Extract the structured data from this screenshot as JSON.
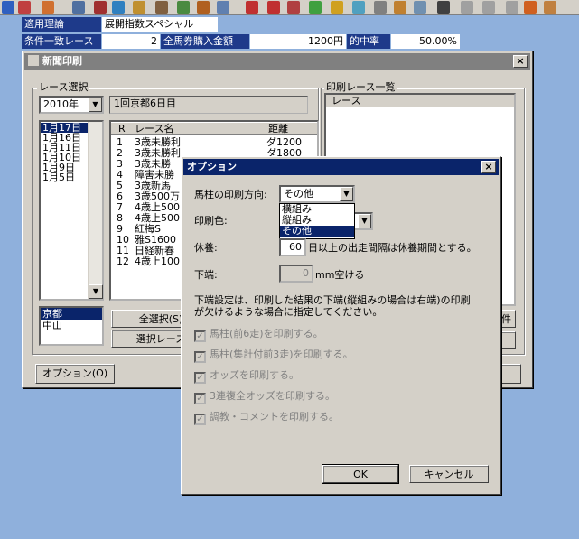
{
  "info": {
    "theory_label": "適用理論",
    "theory_value": "展開指数スペシャル",
    "match_label": "条件一致レース",
    "match_count": "2",
    "total_label": "全馬券購入金額",
    "total_value": "1200円",
    "hit_label": "的中率",
    "hit_value": "50.00%"
  },
  "print_window": {
    "title": "新聞印刷",
    "race_select_group": "レース選択",
    "year": "2010年",
    "meeting": "1回京都6日目",
    "dates": [
      "1月17日",
      "1月16日",
      "1月11日",
      "1月10日",
      "1月9日",
      "1月5日"
    ],
    "venues": [
      "京都",
      "中山"
    ],
    "race_header": {
      "r": "R",
      "name": "レース名",
      "dist": "距離"
    },
    "races": [
      {
        "r": "1",
        "name": "3歳未勝利",
        "dist": "ダ1200"
      },
      {
        "r": "2",
        "name": "3歳未勝利",
        "dist": "ダ1800"
      },
      {
        "r": "3",
        "name": "3歳未勝",
        "dist": ""
      },
      {
        "r": "4",
        "name": "障害未勝",
        "dist": ""
      },
      {
        "r": "5",
        "name": "3歳新馬",
        "dist": ""
      },
      {
        "r": "6",
        "name": "3歳500万",
        "dist": ""
      },
      {
        "r": "7",
        "name": "4歳上500",
        "dist": ""
      },
      {
        "r": "8",
        "name": "4歳上500",
        "dist": ""
      },
      {
        "r": "9",
        "name": "紅梅S",
        "dist": ""
      },
      {
        "r": "10",
        "name": "雅S1600",
        "dist": ""
      },
      {
        "r": "11",
        "name": "日経新春",
        "dist": ""
      },
      {
        "r": "12",
        "name": "4歳上100",
        "dist": ""
      }
    ],
    "select_all_button": "全選択(S)",
    "select_race_button": "選択レース",
    "options_button": "オプション(O)",
    "print_list_group": "印刷レース一覧",
    "print_list_header": "レース",
    "partial_button": "件"
  },
  "options_dialog": {
    "title": "オプション",
    "direction_label": "馬柱の印刷方向:",
    "direction_value": "その他",
    "direction_options": [
      "横組み",
      "縦組み",
      "その他"
    ],
    "color_label": "印刷色:",
    "rest_label": "休養:",
    "rest_value": "60",
    "rest_suffix": "日以上の出走間隔は休養期間とする。",
    "bottom_label": "下端:",
    "bottom_value": "0",
    "bottom_suffix": "mm空ける",
    "note_line1": "下端設定は、印刷した結果の下端(縦組みの場合は右端)の印刷",
    "note_line2": "が欠けるような場合に指定してください。",
    "checks": [
      "馬柱(前6走)を印刷する。",
      "馬柱(集計付前3走)を印刷する。",
      "オッズを印刷する。",
      "3連複全オッズを印刷する。",
      "調教・コメントを印刷する。"
    ],
    "ok_button": "OK",
    "cancel_button": "キャンセル"
  },
  "colors": {
    "accent": "#0a246a",
    "info_bar": "#1e3a8a",
    "desktop": "#8fb0dc",
    "face": "#d4d0c8"
  }
}
